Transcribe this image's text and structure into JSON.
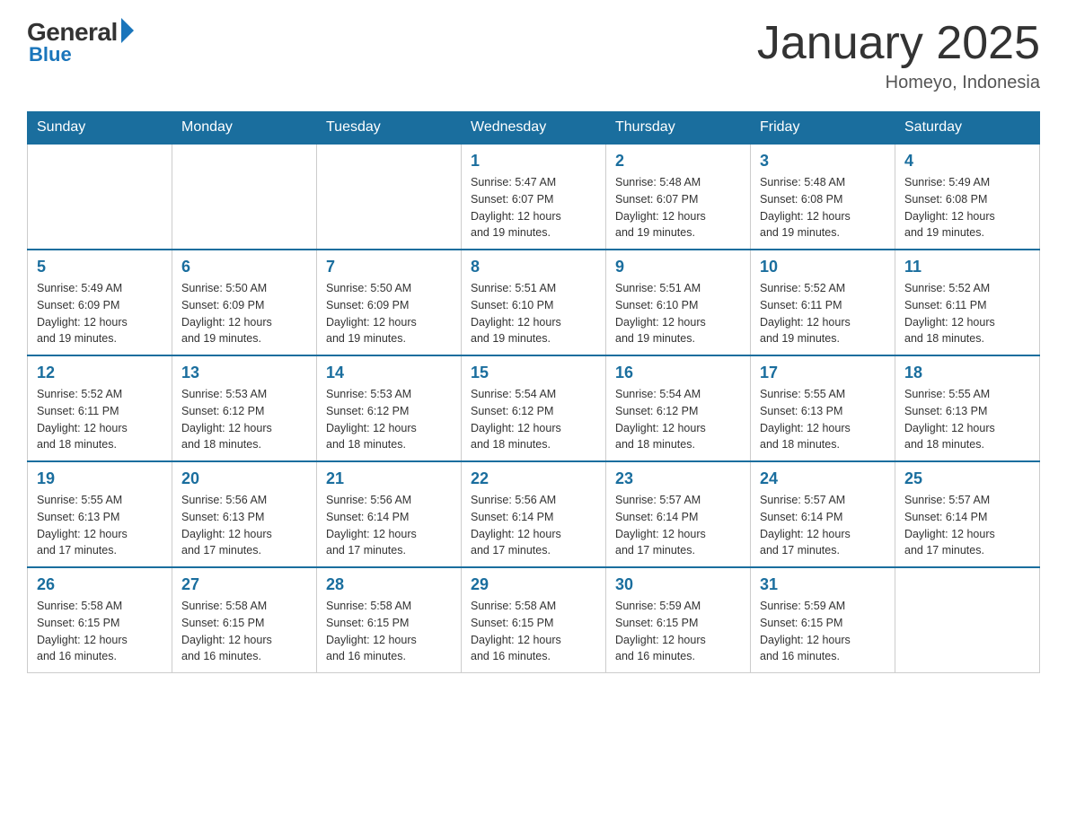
{
  "header": {
    "logo": {
      "general": "General",
      "blue": "Blue"
    },
    "title": "January 2025",
    "location": "Homeyo, Indonesia"
  },
  "days_of_week": [
    "Sunday",
    "Monday",
    "Tuesday",
    "Wednesday",
    "Thursday",
    "Friday",
    "Saturday"
  ],
  "weeks": [
    {
      "days": [
        {
          "number": "",
          "info": ""
        },
        {
          "number": "",
          "info": ""
        },
        {
          "number": "",
          "info": ""
        },
        {
          "number": "1",
          "info": "Sunrise: 5:47 AM\nSunset: 6:07 PM\nDaylight: 12 hours\nand 19 minutes."
        },
        {
          "number": "2",
          "info": "Sunrise: 5:48 AM\nSunset: 6:07 PM\nDaylight: 12 hours\nand 19 minutes."
        },
        {
          "number": "3",
          "info": "Sunrise: 5:48 AM\nSunset: 6:08 PM\nDaylight: 12 hours\nand 19 minutes."
        },
        {
          "number": "4",
          "info": "Sunrise: 5:49 AM\nSunset: 6:08 PM\nDaylight: 12 hours\nand 19 minutes."
        }
      ]
    },
    {
      "days": [
        {
          "number": "5",
          "info": "Sunrise: 5:49 AM\nSunset: 6:09 PM\nDaylight: 12 hours\nand 19 minutes."
        },
        {
          "number": "6",
          "info": "Sunrise: 5:50 AM\nSunset: 6:09 PM\nDaylight: 12 hours\nand 19 minutes."
        },
        {
          "number": "7",
          "info": "Sunrise: 5:50 AM\nSunset: 6:09 PM\nDaylight: 12 hours\nand 19 minutes."
        },
        {
          "number": "8",
          "info": "Sunrise: 5:51 AM\nSunset: 6:10 PM\nDaylight: 12 hours\nand 19 minutes."
        },
        {
          "number": "9",
          "info": "Sunrise: 5:51 AM\nSunset: 6:10 PM\nDaylight: 12 hours\nand 19 minutes."
        },
        {
          "number": "10",
          "info": "Sunrise: 5:52 AM\nSunset: 6:11 PM\nDaylight: 12 hours\nand 19 minutes."
        },
        {
          "number": "11",
          "info": "Sunrise: 5:52 AM\nSunset: 6:11 PM\nDaylight: 12 hours\nand 18 minutes."
        }
      ]
    },
    {
      "days": [
        {
          "number": "12",
          "info": "Sunrise: 5:52 AM\nSunset: 6:11 PM\nDaylight: 12 hours\nand 18 minutes."
        },
        {
          "number": "13",
          "info": "Sunrise: 5:53 AM\nSunset: 6:12 PM\nDaylight: 12 hours\nand 18 minutes."
        },
        {
          "number": "14",
          "info": "Sunrise: 5:53 AM\nSunset: 6:12 PM\nDaylight: 12 hours\nand 18 minutes."
        },
        {
          "number": "15",
          "info": "Sunrise: 5:54 AM\nSunset: 6:12 PM\nDaylight: 12 hours\nand 18 minutes."
        },
        {
          "number": "16",
          "info": "Sunrise: 5:54 AM\nSunset: 6:12 PM\nDaylight: 12 hours\nand 18 minutes."
        },
        {
          "number": "17",
          "info": "Sunrise: 5:55 AM\nSunset: 6:13 PM\nDaylight: 12 hours\nand 18 minutes."
        },
        {
          "number": "18",
          "info": "Sunrise: 5:55 AM\nSunset: 6:13 PM\nDaylight: 12 hours\nand 18 minutes."
        }
      ]
    },
    {
      "days": [
        {
          "number": "19",
          "info": "Sunrise: 5:55 AM\nSunset: 6:13 PM\nDaylight: 12 hours\nand 17 minutes."
        },
        {
          "number": "20",
          "info": "Sunrise: 5:56 AM\nSunset: 6:13 PM\nDaylight: 12 hours\nand 17 minutes."
        },
        {
          "number": "21",
          "info": "Sunrise: 5:56 AM\nSunset: 6:14 PM\nDaylight: 12 hours\nand 17 minutes."
        },
        {
          "number": "22",
          "info": "Sunrise: 5:56 AM\nSunset: 6:14 PM\nDaylight: 12 hours\nand 17 minutes."
        },
        {
          "number": "23",
          "info": "Sunrise: 5:57 AM\nSunset: 6:14 PM\nDaylight: 12 hours\nand 17 minutes."
        },
        {
          "number": "24",
          "info": "Sunrise: 5:57 AM\nSunset: 6:14 PM\nDaylight: 12 hours\nand 17 minutes."
        },
        {
          "number": "25",
          "info": "Sunrise: 5:57 AM\nSunset: 6:14 PM\nDaylight: 12 hours\nand 17 minutes."
        }
      ]
    },
    {
      "days": [
        {
          "number": "26",
          "info": "Sunrise: 5:58 AM\nSunset: 6:15 PM\nDaylight: 12 hours\nand 16 minutes."
        },
        {
          "number": "27",
          "info": "Sunrise: 5:58 AM\nSunset: 6:15 PM\nDaylight: 12 hours\nand 16 minutes."
        },
        {
          "number": "28",
          "info": "Sunrise: 5:58 AM\nSunset: 6:15 PM\nDaylight: 12 hours\nand 16 minutes."
        },
        {
          "number": "29",
          "info": "Sunrise: 5:58 AM\nSunset: 6:15 PM\nDaylight: 12 hours\nand 16 minutes."
        },
        {
          "number": "30",
          "info": "Sunrise: 5:59 AM\nSunset: 6:15 PM\nDaylight: 12 hours\nand 16 minutes."
        },
        {
          "number": "31",
          "info": "Sunrise: 5:59 AM\nSunset: 6:15 PM\nDaylight: 12 hours\nand 16 minutes."
        },
        {
          "number": "",
          "info": ""
        }
      ]
    }
  ]
}
